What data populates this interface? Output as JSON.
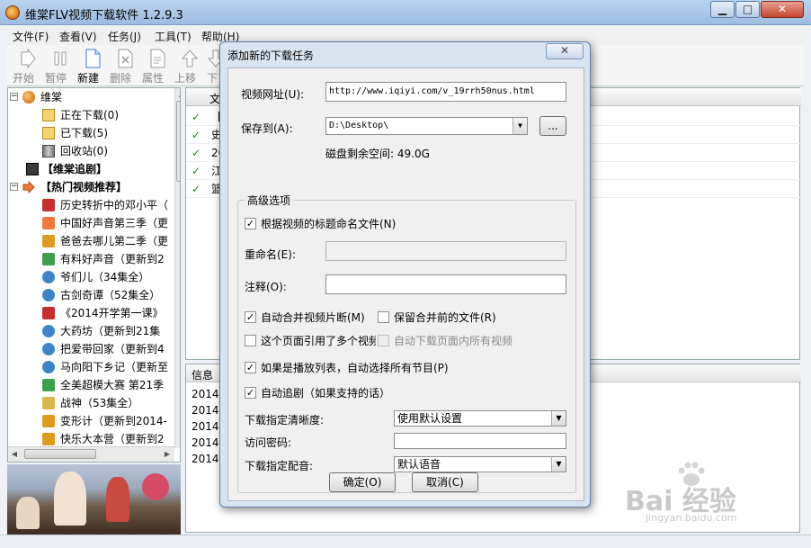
{
  "window": {
    "title": "维棠FLV视频下载软件 1.2.9.3",
    "min": "▁",
    "max": "□",
    "close": "✕"
  },
  "menu": [
    "文件(F)",
    "查看(V)",
    "任务(J)",
    "工具(T)",
    "帮助(H)"
  ],
  "toolbar": [
    {
      "label": "开始",
      "icon": "play-icon",
      "active": false
    },
    {
      "label": "暂停",
      "icon": "pause-icon",
      "active": false
    },
    {
      "label": "新建",
      "icon": "new-file-icon",
      "active": true
    },
    {
      "label": "删除",
      "icon": "delete-icon",
      "active": false
    },
    {
      "label": "属性",
      "icon": "properties-icon",
      "active": false
    },
    {
      "label": "上移",
      "icon": "up-icon",
      "active": false
    },
    {
      "label": "下",
      "icon": "down-icon",
      "active": false
    }
  ],
  "tree": {
    "root": "维棠",
    "children": [
      "正在下载(0)",
      "已下载(5)",
      "回收站(0)"
    ],
    "tv": "【维棠追剧】",
    "hot": "【热门视频推荐】",
    "hot_items": [
      "历史转折中的邓小平（",
      "中国好声音第三季（更",
      "爸爸去哪儿第二季（更",
      "有料好声音（更新到2",
      "爷们儿（34集全）",
      "古剑奇谭（52集全）",
      "《2014开学第一课》",
      "大药坊（更新到21集",
      "把爱带回家（更新到4",
      "马向阳下乡记（更新至",
      "全美超模大赛 第21季",
      "战神（53集全）",
      "变形计（更新到2014-",
      "快乐大本营（更新到2"
    ],
    "scroll_arrow": "▾"
  },
  "list": {
    "header": "文",
    "rows": [
      {
        "check": "✓",
        "text": "【"
      },
      {
        "check": "✓",
        "text": "史"
      },
      {
        "check": "✓",
        "text": "20"
      },
      {
        "check": "✓",
        "text": "江"
      },
      {
        "check": "✓",
        "text": "篮"
      }
    ]
  },
  "info": {
    "header": "信息",
    "rows": [
      "2014-",
      "2014-",
      "2014-",
      "2014-",
      "2014-"
    ]
  },
  "dialog": {
    "title": "添加新的下载任务",
    "close": "✕",
    "url_label": "视频网址(U):",
    "url_value": "http://www.iqiyi.com/v_19rrh50nus.html",
    "save_label": "保存到(A):",
    "save_value": "D:\\Desktop\\",
    "browse": "...",
    "disk_free": "磁盘剩余空间: 49.0G",
    "advanced": "高级选项",
    "opt_rename_by_title": "根据视频的标题命名文件(N)",
    "rename_label": "重命名(E):",
    "note_label": "注释(O):",
    "opt_merge": "自动合并视频片断(M)",
    "opt_keep": "保留合并前的文件(R)",
    "opt_multi": "这个页面引用了多个视频",
    "opt_all": "自动下载页面内所有视频",
    "opt_playlist": "如果是播放列表，自动选择所有节目(P)",
    "opt_follow": "自动追剧（如果支持的话）",
    "quality_label": "下载指定清晰度:",
    "quality_value": "使用默认设置",
    "password_label": "访问密码:",
    "audio_label": "下载指定配音:",
    "audio_value": "默认语音",
    "ok": "确定(O)",
    "cancel": "取消(C)"
  },
  "watermark": {
    "text": "Bai 经验",
    "url": "jingyan.baidu.com"
  }
}
